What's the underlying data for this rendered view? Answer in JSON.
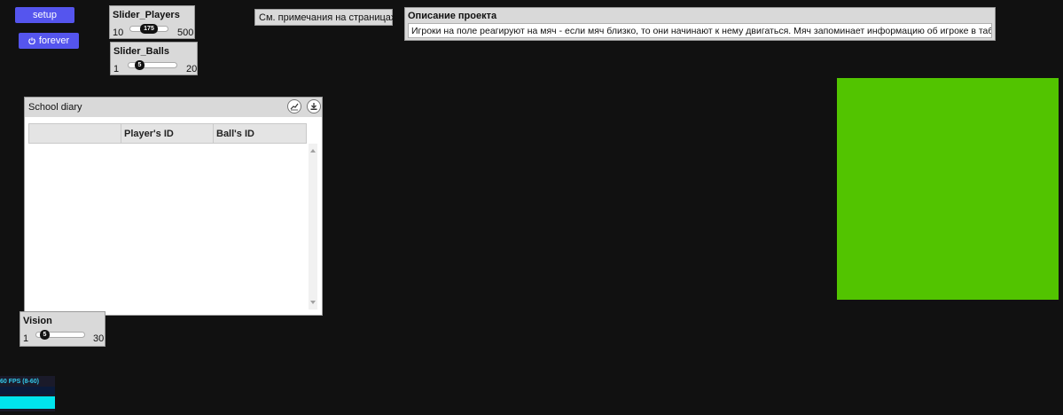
{
  "buttons": {
    "setup_label": "setup",
    "forever_label": "forever",
    "forever_icon": "power-icon",
    "color": "#5555ee"
  },
  "sliders": {
    "players": {
      "title": "Slider_Players",
      "min": "10",
      "max": "500",
      "value": "175",
      "fraction": 0.337
    },
    "balls": {
      "title": "Slider_Balls",
      "min": "1",
      "max": "20",
      "value": "5",
      "fraction": 0.21
    },
    "vision": {
      "title": "Vision",
      "min": "1",
      "max": "30",
      "value": "5",
      "fraction": 0.138
    }
  },
  "note": {
    "text": "См. примечания на страницах"
  },
  "description": {
    "title": "Описание проекта",
    "body": "Игроки на поле реагируют на мяч - если мяч близко, то они начинают к нему двигаться. Мяч запоминает информацию об игроке в таблице"
  },
  "table": {
    "title": "School diary",
    "columns": [
      "",
      "Player's ID",
      "Ball's ID"
    ],
    "rows": [],
    "icons": [
      "chart-icon",
      "download-icon"
    ]
  },
  "world": {
    "color": "#52c400"
  },
  "fps": {
    "text": "60 FPS (8-60)",
    "fill_fraction": 1.0,
    "color": "#00e5ee"
  },
  "colors": {
    "background": "#111111",
    "panel": "#d9d9d9"
  }
}
